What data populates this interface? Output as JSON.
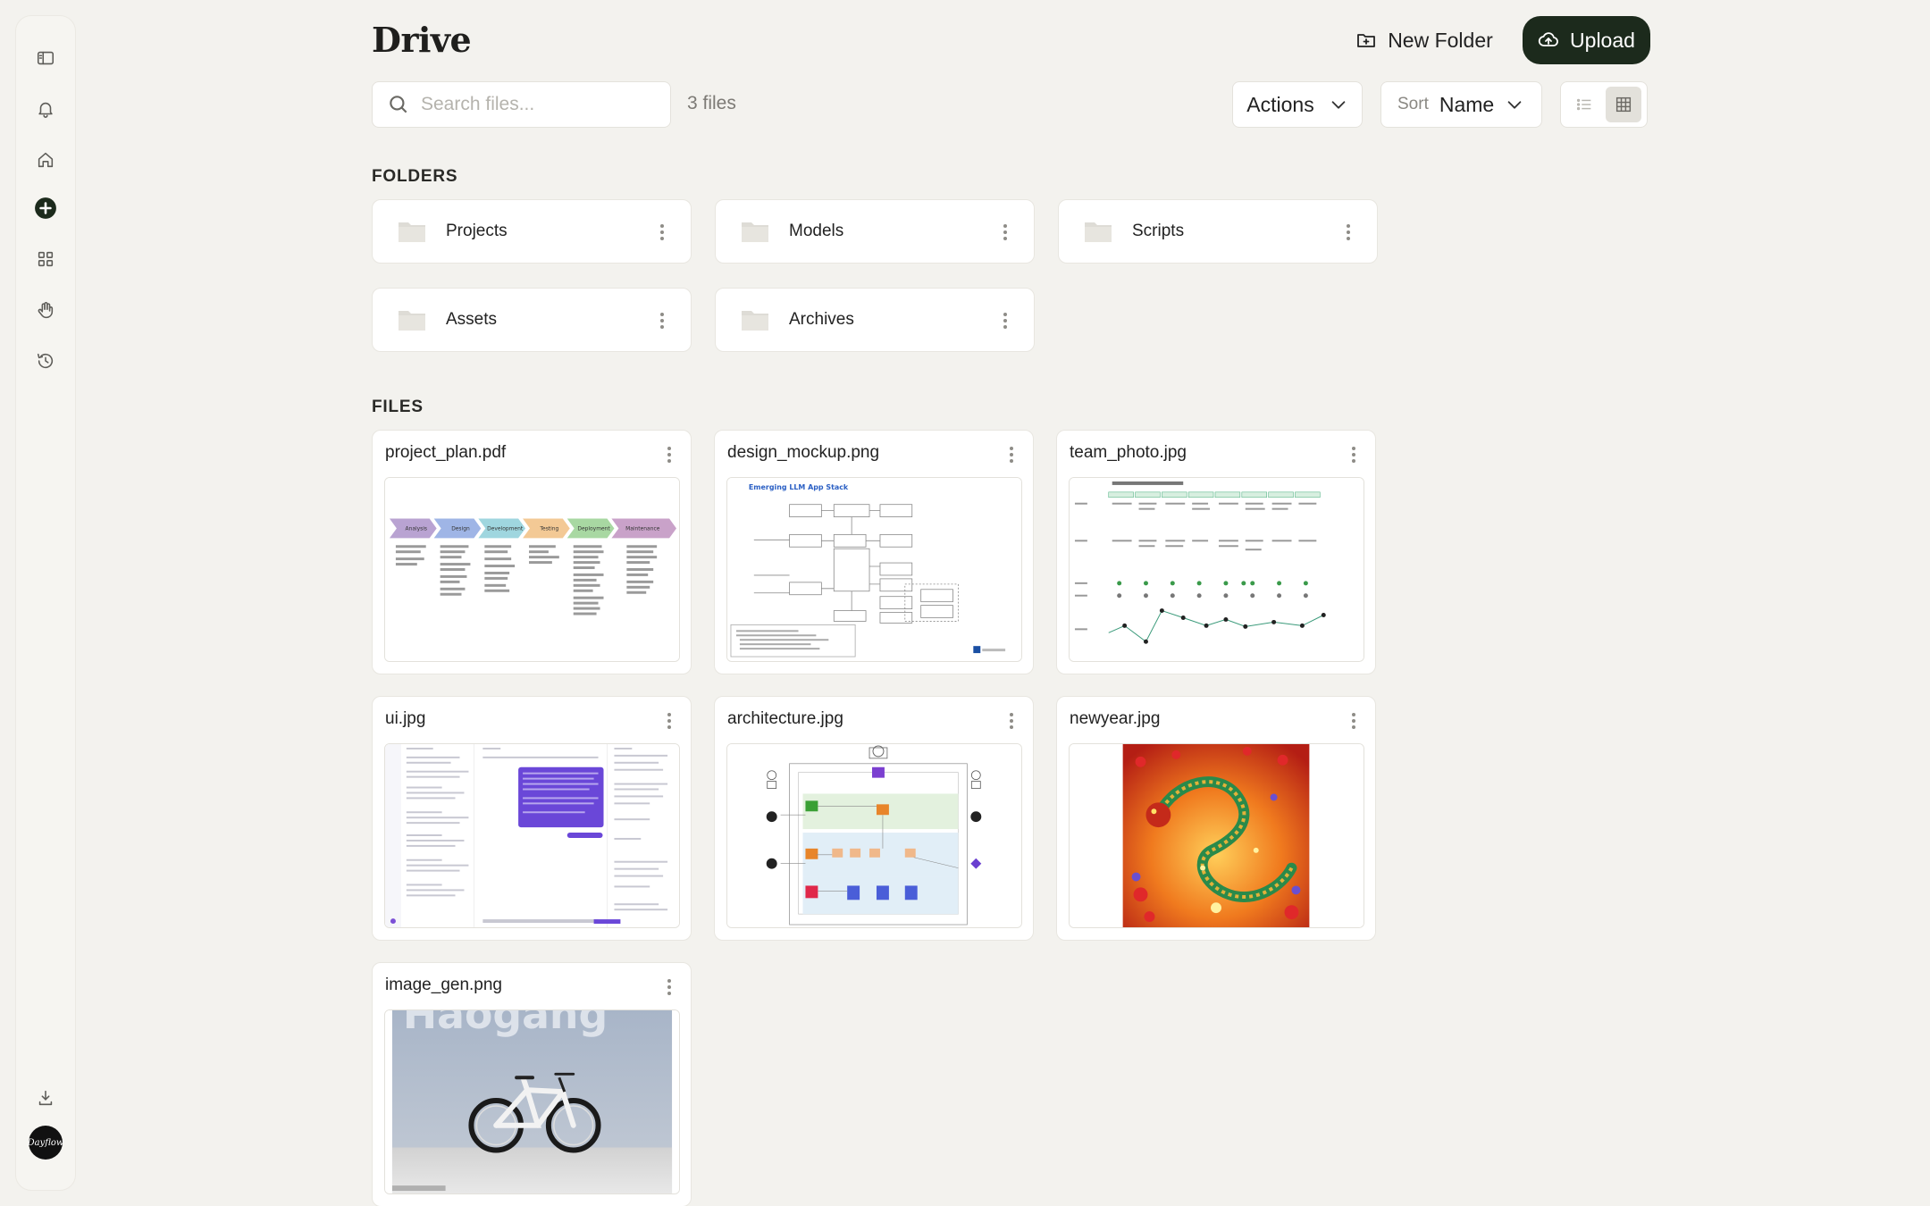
{
  "header": {
    "title": "Drive",
    "new_folder_label": "New Folder",
    "upload_label": "Upload"
  },
  "toolbar": {
    "search_placeholder": "Search files...",
    "file_count": "3 files",
    "actions_label": "Actions",
    "sort_label": "Sort",
    "sort_value": "Name",
    "view_mode": "grid"
  },
  "folders_section": {
    "label": "FOLDERS",
    "items": [
      {
        "name": "Projects"
      },
      {
        "name": "Models"
      },
      {
        "name": "Scripts"
      },
      {
        "name": "Assets"
      },
      {
        "name": "Archives"
      }
    ]
  },
  "files_section": {
    "label": "FILES",
    "items": [
      {
        "name": "project_plan.pdf"
      },
      {
        "name": "design_mockup.png"
      },
      {
        "name": "team_photo.jpg"
      },
      {
        "name": "ui.jpg"
      },
      {
        "name": "architecture.jpg"
      },
      {
        "name": "newyear.jpg"
      },
      {
        "name": "image_gen.png"
      }
    ]
  },
  "thumbnails": {
    "project_plan_stages": [
      "Analysis",
      "Design",
      "Development",
      "Testing",
      "Deployment",
      "Maintenance"
    ],
    "design_mockup_title": "Emerging LLM App Stack",
    "image_gen_text": "Haogang"
  },
  "sidebar": {
    "icons": [
      "panel-icon",
      "bell-icon",
      "home-icon",
      "add-icon",
      "apps-icon",
      "hand-icon",
      "history-icon",
      "download-icon"
    ],
    "avatar_text": "Dayflow"
  },
  "colors": {
    "accent": "#1c2a1c",
    "background": "#f3f2ee"
  }
}
